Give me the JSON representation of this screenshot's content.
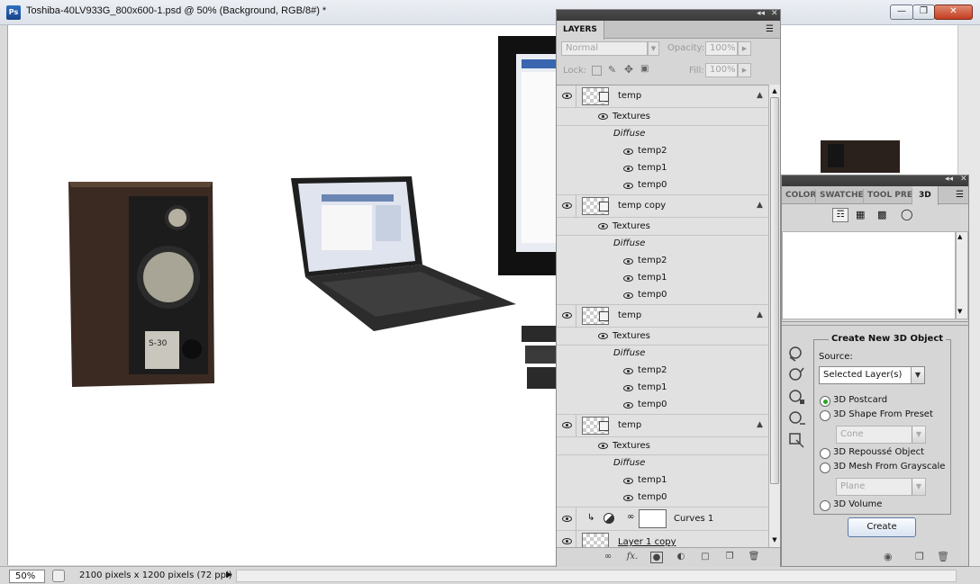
{
  "window": {
    "app_icon": "Ps",
    "title": "Toshiba-40LV933G_800x600-1.psd @ 50% (Background, RGB/8#) *",
    "minimize_icon": "minimize-icon",
    "maximize_icon": "restore-icon",
    "close_icon": "close-icon"
  },
  "canvas": {
    "objects": [
      "speaker",
      "laptop",
      "monitor",
      "tv",
      "stack"
    ],
    "speaker_label": "S-30"
  },
  "statusbar": {
    "zoom": "50%",
    "doc_info": "2100 pixels x 1200 pixels (72 ppi)"
  },
  "layers_panel": {
    "tab": "LAYERS",
    "blend_mode": "Normal",
    "opacity_label": "Opacity:",
    "opacity_value": "100%",
    "lock_label": "Lock:",
    "fill_label": "Fill:",
    "fill_value": "100%",
    "groups": [
      {
        "name": "temp",
        "textures": "Textures",
        "diffuse": "Diffuse",
        "maps": [
          "temp2",
          "temp1",
          "temp0"
        ]
      },
      {
        "name": "temp copy",
        "textures": "Textures",
        "diffuse": "Diffuse",
        "maps": [
          "temp2",
          "temp1",
          "temp0"
        ]
      },
      {
        "name": "temp",
        "textures": "Textures",
        "diffuse": "Diffuse",
        "maps": [
          "temp2",
          "temp1",
          "temp0"
        ]
      },
      {
        "name": "temp",
        "textures": "Textures",
        "diffuse": "Diffuse",
        "maps": [
          "temp1",
          "temp0"
        ]
      }
    ],
    "curves_layer": "Curves 1",
    "last_layer": "Layer 1 copy",
    "footer_icons": [
      "link-layers-icon",
      "fx-icon",
      "add-mask-icon",
      "adjustment-layer-icon",
      "new-group-icon",
      "new-layer-icon",
      "delete-layer-icon"
    ]
  },
  "panel3d": {
    "tabs": [
      "COLOR",
      "SWATCHES",
      "TOOL PRESETS",
      "3D"
    ],
    "active_tab": "3D",
    "filter_icons": [
      "scene-filter-icon",
      "mesh-filter-icon",
      "material-filter-icon",
      "light-filter-icon"
    ],
    "create_title": "Create New 3D Object",
    "source_label": "Source:",
    "source_value": "Selected Layer(s)",
    "options": [
      {
        "label": "3D Postcard",
        "selected": true
      },
      {
        "label": "3D Shape From Preset",
        "selected": false
      },
      {
        "label": "3D Repoussé Object",
        "selected": false
      },
      {
        "label": "3D Mesh From Grayscale",
        "selected": false
      },
      {
        "label": "3D Volume",
        "selected": false
      }
    ],
    "preset_value": "Cone",
    "grayscale_value": "Plane",
    "create_button": "Create"
  },
  "colors": {
    "accent": "#2f6fc0",
    "panel_bg": "#d6d6d6",
    "radio_on": "#2aa32a"
  }
}
